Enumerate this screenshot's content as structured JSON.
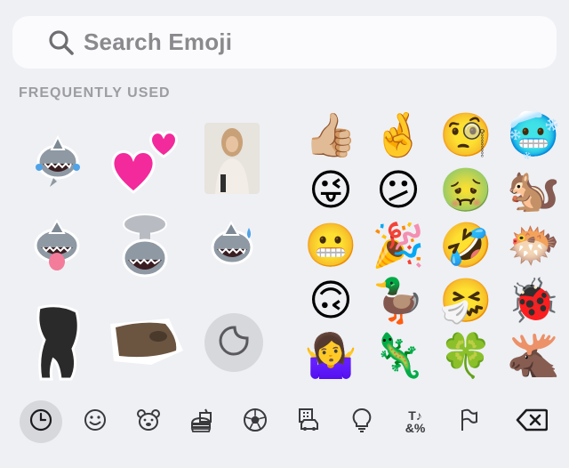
{
  "search": {
    "placeholder": "Search Emoji"
  },
  "section": {
    "title": "FREQUENTLY USED"
  },
  "stickers": [
    {
      "name": "shark-laughing-sticker"
    },
    {
      "name": "two-hearts-sticker"
    },
    {
      "name": "person-photo-sticker"
    },
    {
      "name": "shark-tongue-sticker"
    },
    {
      "name": "shark-mind-blown-sticker"
    },
    {
      "name": "shark-sweat-sticker"
    },
    {
      "name": "dog-photo-sticker"
    },
    {
      "name": "dog-lying-sticker"
    }
  ],
  "emoji_rows": [
    [
      "👍🏼",
      "🤞",
      "🧐",
      "🥶"
    ],
    [
      "😜",
      "😕",
      "🤢",
      "🐿️"
    ],
    [
      "😬",
      "🎉",
      "🤣",
      "🐡"
    ],
    [
      "🙃",
      "🦆",
      "🤧",
      "🐞"
    ],
    [
      "🤷‍♀️",
      "🦎",
      "🍀",
      "🫎"
    ]
  ],
  "tabs": [
    {
      "name": "recent-tab",
      "icon": "clock-icon"
    },
    {
      "name": "smileys-tab",
      "icon": "smiley-icon"
    },
    {
      "name": "animals-tab",
      "icon": "bear-icon"
    },
    {
      "name": "food-tab",
      "icon": "burger-drink-icon"
    },
    {
      "name": "activity-tab",
      "icon": "soccer-ball-icon"
    },
    {
      "name": "travel-tab",
      "icon": "building-car-icon"
    },
    {
      "name": "objects-tab",
      "icon": "lightbulb-icon"
    },
    {
      "name": "symbols-tab",
      "icon": "symbols-icon",
      "glyph": "T♪ &%"
    },
    {
      "name": "flags-tab",
      "icon": "flag-icon"
    },
    {
      "name": "delete-key",
      "icon": "backspace-icon"
    }
  ],
  "colors": {
    "background": "#EEF0F4",
    "search_bg": "#FBFBFD",
    "placeholder": "#8A8A8E",
    "section_title": "#9C9CA1",
    "active_tab": "#D7D8DC"
  }
}
